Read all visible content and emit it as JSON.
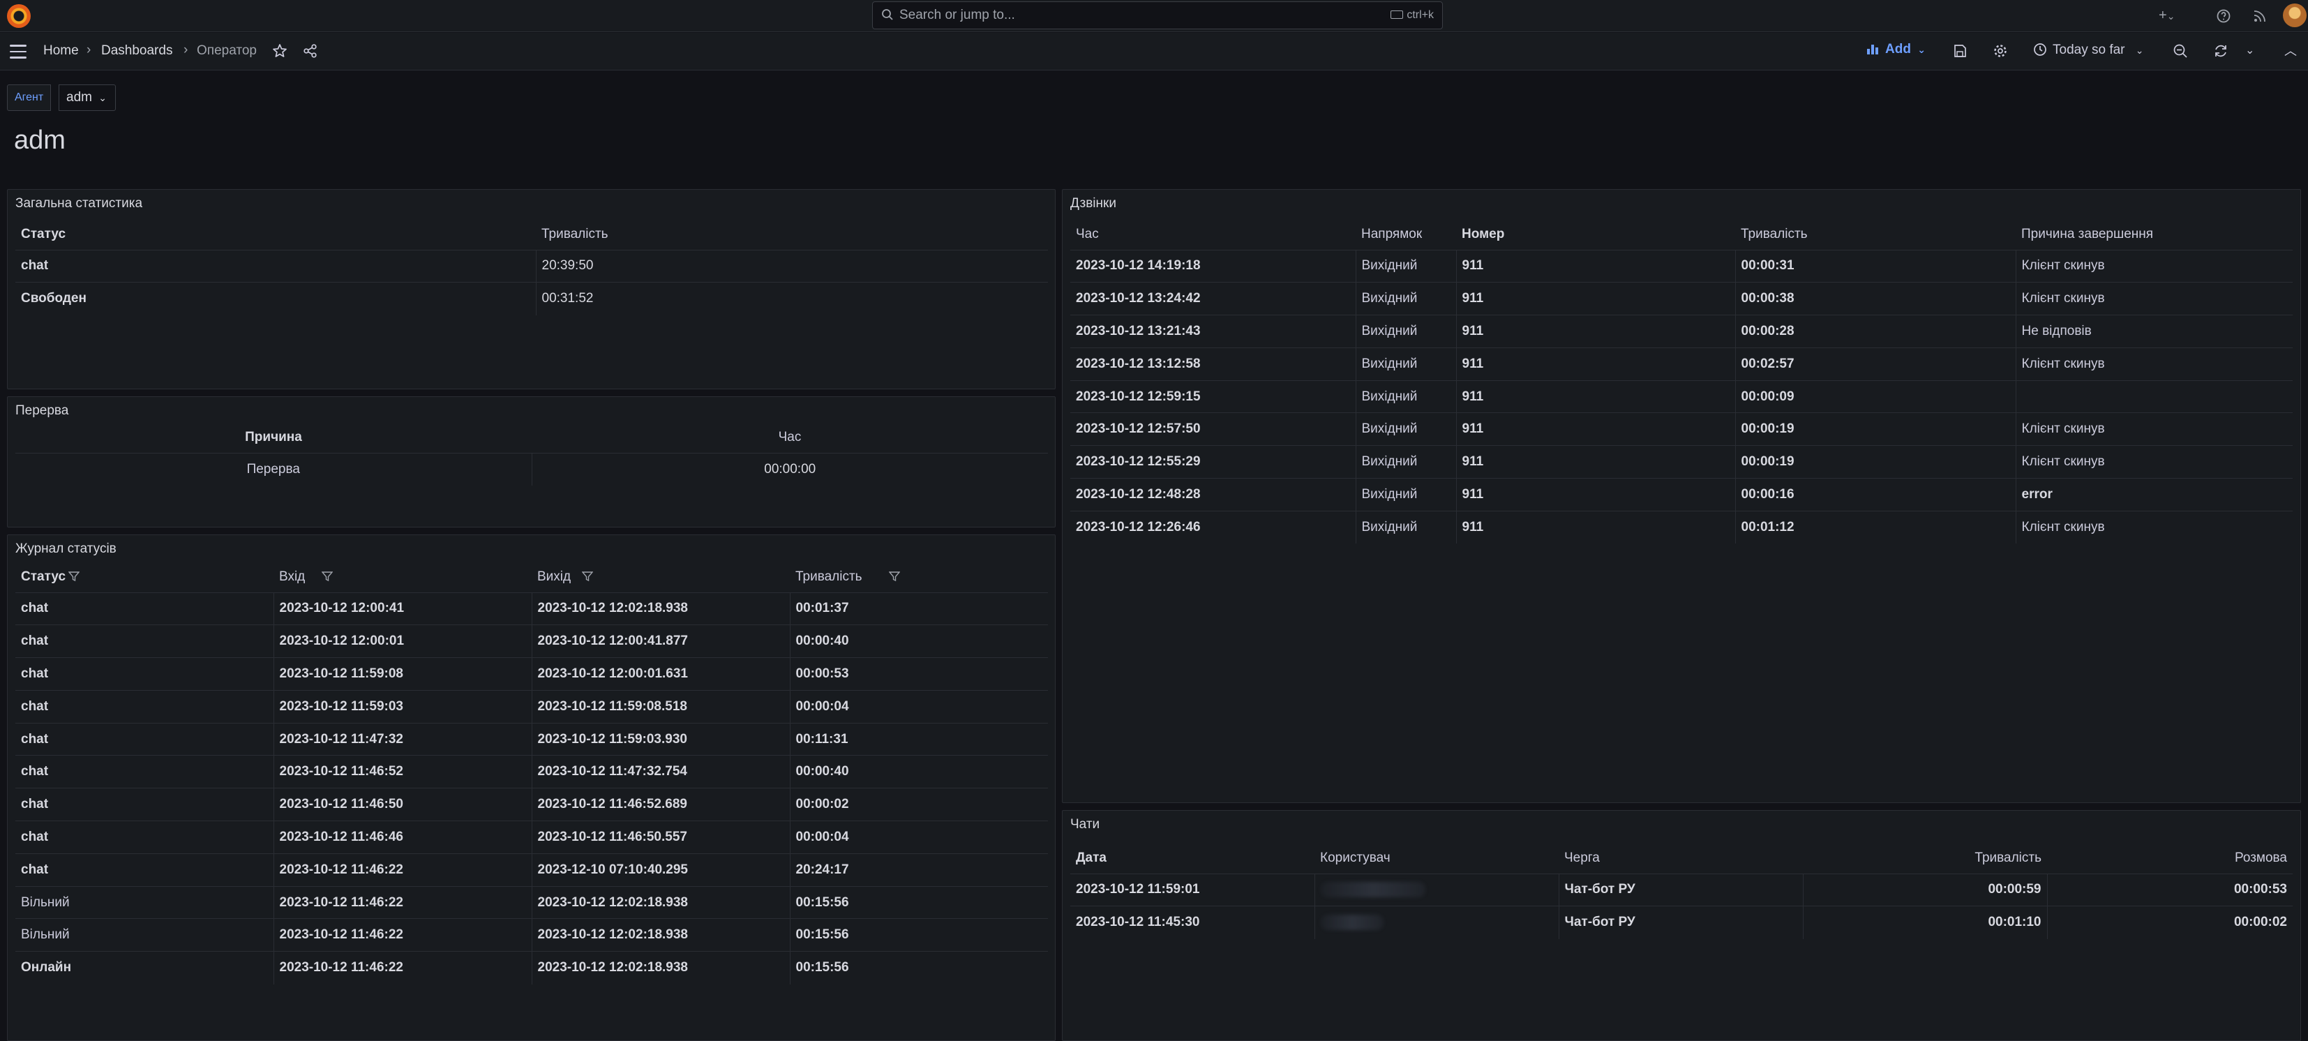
{
  "topbar": {
    "search_placeholder": "Search or jump to...",
    "search_shortcut": "ctrl+k",
    "plus_label": "+",
    "chevron": "⌄"
  },
  "nav": {
    "breadcrumbs": [
      "Home",
      "Dashboards",
      "Оператор"
    ],
    "add_label": "Add",
    "time_range": "Today so far"
  },
  "variables": {
    "label": "Агент",
    "value": "adm"
  },
  "page_title": "adm",
  "panels": {
    "general_stats": {
      "title": "Загальна статистика",
      "columns": [
        "Статус",
        "Тривалість"
      ],
      "rows": [
        [
          "chat",
          "20:39:50"
        ],
        [
          "Свободен",
          "00:31:52"
        ]
      ]
    },
    "break": {
      "title": "Перерва",
      "columns": [
        "Причина",
        "Час"
      ],
      "rows": [
        [
          "Перерва",
          "00:00:00"
        ]
      ]
    },
    "status_log": {
      "title": "Журнал статусів",
      "columns": [
        "Статус",
        "Вхід",
        "Вихід",
        "Тривалість"
      ],
      "rows": [
        [
          "chat",
          "2023-10-12 12:00:41",
          "2023-10-12 12:02:18.938",
          "00:01:37"
        ],
        [
          "chat",
          "2023-10-12 12:00:01",
          "2023-10-12 12:00:41.877",
          "00:00:40"
        ],
        [
          "chat",
          "2023-10-12 11:59:08",
          "2023-10-12 12:00:01.631",
          "00:00:53"
        ],
        [
          "chat",
          "2023-10-12 11:59:03",
          "2023-10-12 11:59:08.518",
          "00:00:04"
        ],
        [
          "chat",
          "2023-10-12 11:47:32",
          "2023-10-12 11:59:03.930",
          "00:11:31"
        ],
        [
          "chat",
          "2023-10-12 11:46:52",
          "2023-10-12 11:47:32.754",
          "00:00:40"
        ],
        [
          "chat",
          "2023-10-12 11:46:50",
          "2023-10-12 11:46:52.689",
          "00:00:02"
        ],
        [
          "chat",
          "2023-10-12 11:46:46",
          "2023-10-12 11:46:50.557",
          "00:00:04"
        ],
        [
          "chat",
          "2023-10-12 11:46:22",
          "2023-12-10 07:10:40.295",
          "20:24:17"
        ],
        [
          "Вільний",
          "2023-10-12 11:46:22",
          "2023-10-12 12:02:18.938",
          "00:15:56"
        ],
        [
          "Вільний",
          "2023-10-12 11:46:22",
          "2023-10-12 12:02:18.938",
          "00:15:56"
        ],
        [
          "Онлайн",
          "2023-10-12 11:46:22",
          "2023-10-12 12:02:18.938",
          "00:15:56"
        ]
      ]
    },
    "calls": {
      "title": "Дзвінки",
      "columns": [
        "Час",
        "Напрямок",
        "Номер",
        "Тривалість",
        "Причина завершення"
      ],
      "rows": [
        [
          "2023-10-12 14:19:18",
          "Вихідний",
          "911",
          "00:00:31",
          "Клієнт скинув"
        ],
        [
          "2023-10-12 13:24:42",
          "Вихідний",
          "911",
          "00:00:38",
          "Клієнт скинув"
        ],
        [
          "2023-10-12 13:21:43",
          "Вихідний",
          "911",
          "00:00:28",
          "Не відповів"
        ],
        [
          "2023-10-12 13:12:58",
          "Вихідний",
          "911",
          "00:02:57",
          "Клієнт скинув"
        ],
        [
          "2023-10-12 12:59:15",
          "Вихідний",
          "911",
          "00:00:09",
          ""
        ],
        [
          "2023-10-12 12:57:50",
          "Вихідний",
          "911",
          "00:00:19",
          "Клієнт скинув"
        ],
        [
          "2023-10-12 12:55:29",
          "Вихідний",
          "911",
          "00:00:19",
          "Клієнт скинув"
        ],
        [
          "2023-10-12 12:48:28",
          "Вихідний",
          "911",
          "00:00:16",
          "error"
        ],
        [
          "2023-10-12 12:26:46",
          "Вихідний",
          "911",
          "00:01:12",
          "Клієнт скинув"
        ]
      ]
    },
    "chats": {
      "title": "Чати",
      "columns": [
        "Дата",
        "Користувач",
        "Черга",
        "Тривалість",
        "Розмова"
      ],
      "rows": [
        [
          "2023-10-12 11:59:01",
          "",
          "Чат-бот РУ",
          "00:00:59",
          "00:00:53"
        ],
        [
          "2023-10-12 11:45:30",
          "",
          "Чат-бот РУ",
          "00:01:10",
          "00:00:02"
        ]
      ]
    }
  }
}
